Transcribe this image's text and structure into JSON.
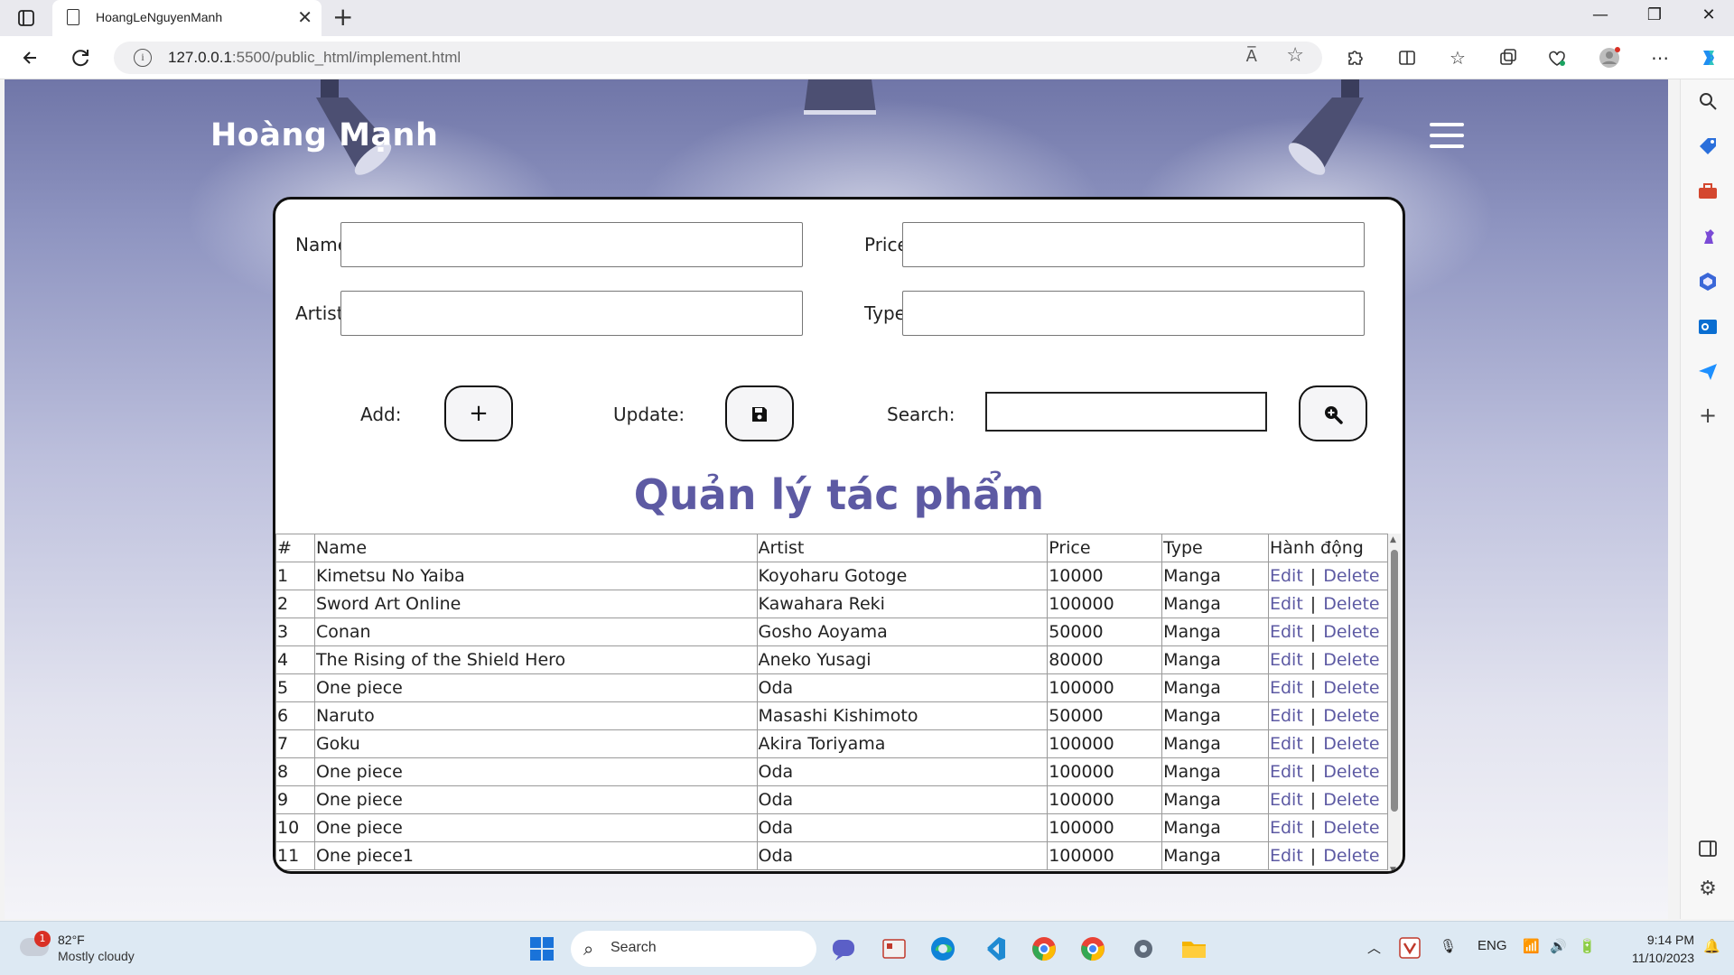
{
  "browser": {
    "tab_title": "HoangLeNguyenManh",
    "tab_close": "✕",
    "new_tab": "+",
    "url_host": "127.0.0.1",
    "url_rest": ":5500/public_html/implement.html",
    "read_aloud": "A̅",
    "window": {
      "minimize": "—",
      "restore": "❐",
      "close": "✕"
    }
  },
  "page": {
    "brand": "Hoàng Mạnh",
    "form": {
      "name_label": "Name:",
      "price_label": "Price:",
      "artist_label": "Artist:",
      "type_label": "Type:",
      "name_value": "",
      "price_value": "",
      "artist_value": "",
      "type_value": "",
      "add_label": "Add:",
      "update_label": "Update:",
      "search_label": "Search:",
      "search_value": "",
      "add_glyph": "+",
      "update_glyph": "💾",
      "search_glyph": "🔍"
    },
    "heading": "Quản lý tác phẩm",
    "table": {
      "headers": [
        "#",
        "Name",
        "Artist",
        "Price",
        "Type",
        "Hành động"
      ],
      "edit_label": "Edit",
      "sep": "|",
      "delete_label": "Delete",
      "rows": [
        {
          "id": "1",
          "name": "Kimetsu No Yaiba",
          "artist": "Koyoharu Gotoge",
          "price": "10000",
          "type": "Manga"
        },
        {
          "id": "2",
          "name": "Sword Art Online",
          "artist": "Kawahara Reki",
          "price": "100000",
          "type": "Manga"
        },
        {
          "id": "3",
          "name": "Conan",
          "artist": "Gosho Aoyama",
          "price": "50000",
          "type": "Manga"
        },
        {
          "id": "4",
          "name": "The Rising of the Shield Hero",
          "artist": "Aneko Yusagi",
          "price": "80000",
          "type": "Manga"
        },
        {
          "id": "5",
          "name": "One piece",
          "artist": "Oda",
          "price": "100000",
          "type": "Manga"
        },
        {
          "id": "6",
          "name": "Naruto",
          "artist": "Masashi Kishimoto",
          "price": "50000",
          "type": "Manga"
        },
        {
          "id": "7",
          "name": "Goku",
          "artist": "Akira Toriyama",
          "price": "100000",
          "type": "Manga"
        },
        {
          "id": "8",
          "name": "One piece",
          "artist": "Oda",
          "price": "100000",
          "type": "Manga"
        },
        {
          "id": "9",
          "name": "One piece",
          "artist": "Oda",
          "price": "100000",
          "type": "Manga"
        },
        {
          "id": "10",
          "name": "One piece",
          "artist": "Oda",
          "price": "100000",
          "type": "Manga"
        },
        {
          "id": "11",
          "name": "One piece1",
          "artist": "Oda",
          "price": "100000",
          "type": "Manga"
        }
      ]
    }
  },
  "taskbar": {
    "temp": "82°F",
    "weather_desc": "Mostly cloudy",
    "weather_badge": "1",
    "search_placeholder": "Search",
    "lang": "ENG",
    "time": "9:14 PM",
    "date": "11/10/2023"
  },
  "colors": {
    "accent": "#5d5aa3",
    "bg_top": "#7076a8",
    "bg_bottom": "#f4f4f8"
  }
}
